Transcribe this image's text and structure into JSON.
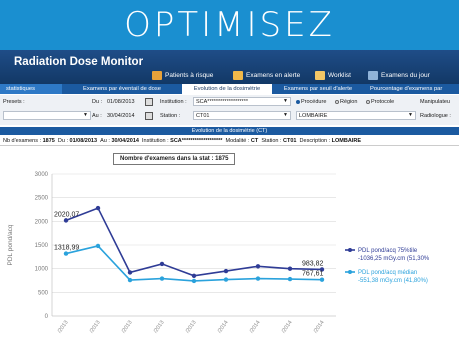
{
  "banner": {
    "title": "OPTIMISEZ"
  },
  "app": {
    "title": "Radiation Dose Monitor",
    "nav": [
      {
        "label": "Patients à risque",
        "icon": "patients-icon"
      },
      {
        "label": "Examens en alerte",
        "icon": "alert-icon"
      },
      {
        "label": "Worklist",
        "icon": "folder-icon"
      },
      {
        "label": "Examens du jour",
        "icon": "calendar-icon"
      }
    ]
  },
  "tabs": [
    "statistiques",
    "Examens par éventail de dose",
    "Evolution de la dosimétrie",
    "Examens par seuil d'alerte",
    "Pourcentage d'examens par"
  ],
  "filters": {
    "presets_label": "Presets :",
    "du_label": "Du :",
    "du_value": "01/08/2013",
    "au_label": "Au :",
    "au_value": "30/04/2014",
    "institution_label": "Institution :",
    "institution_value": "SCA*******************",
    "station_label": "Station :",
    "station_value": "CT01",
    "radio_procedure": "Procédure",
    "radio_region": "Région",
    "radio_protocole": "Protocole",
    "region_value": "LOMBAIRE",
    "manipulateur_label": "Manipulateu",
    "radiologue_label": "Radiologue :"
  },
  "evolution_header": "Evolution de la dosimétrie (CT)",
  "summary": {
    "nb_label": "Nb d'examens :",
    "nb_value": "1875",
    "du_label": "Du :",
    "du_value": "01/08/2013",
    "au_label": "Au :",
    "au_value": "30/04/2014",
    "institution_label": "Institution :",
    "institution_value": "SCA*******************",
    "modalite_label": "Modalité :",
    "modalite_value": "CT",
    "station_label": "Station :",
    "station_value": "CT01",
    "description_label": "Description :",
    "description_value": "LOMBAIRE"
  },
  "stat_box": "Nombre d'examens dans la stat : 1875",
  "colors": {
    "banner": "#1a8fd0",
    "appbar": "#1f4d88",
    "tabs": "#1b5aa0",
    "series1": "#2f3c96",
    "series2": "#2aa2dc"
  },
  "chart_data": {
    "type": "line",
    "ylabel": "PDL pond/acq",
    "ylim": [
      0,
      3000
    ],
    "yticks": [
      "0",
      "500",
      "1000",
      "1500",
      "2000",
      "2500",
      "3000"
    ],
    "categories": [
      "/2013",
      "/2013",
      "/2013",
      "/2013",
      "/2013",
      "/2014",
      "/2014",
      "/2014",
      "/2014"
    ],
    "series": [
      {
        "name": "PDL pond/acq 75%tile",
        "legend_value": "-1036,25 mGy.cm (51,30%",
        "values": [
          2020.07,
          2280,
          920,
          1100,
          850,
          950,
          1050,
          1000,
          983.82
        ]
      },
      {
        "name": "PDL pond/acq médian",
        "legend_value": "-551,38 mGy.cm (41,80%)",
        "values": [
          1318.99,
          1480,
          760,
          790,
          740,
          770,
          790,
          780,
          767.61
        ]
      }
    ],
    "annotations": [
      {
        "series": 0,
        "index": 0,
        "text": "2020,07"
      },
      {
        "series": 1,
        "index": 0,
        "text": "1318,99"
      },
      {
        "series": 0,
        "index": 8,
        "text": "983,82"
      },
      {
        "series": 1,
        "index": 8,
        "text": "767,61"
      }
    ],
    "grid": true,
    "legend": "right"
  }
}
